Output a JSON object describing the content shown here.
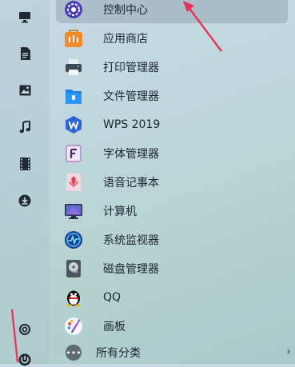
{
  "sidebar": {
    "icons": [
      "computer-icon",
      "document-icon",
      "picture-icon",
      "music-icon",
      "video-icon",
      "download-icon",
      "settings-icon",
      "power-icon"
    ]
  },
  "apps": [
    {
      "label": "控制中心",
      "icon": "control-center-icon",
      "active": true
    },
    {
      "label": "应用商店",
      "icon": "app-store-icon",
      "active": false
    },
    {
      "label": "打印管理器",
      "icon": "printer-icon",
      "active": false
    },
    {
      "label": "文件管理器",
      "icon": "file-manager-icon",
      "active": false
    },
    {
      "label": "WPS 2019",
      "icon": "wps-icon",
      "active": false
    },
    {
      "label": "字体管理器",
      "icon": "font-manager-icon",
      "active": false
    },
    {
      "label": "语音记事本",
      "icon": "voice-notepad-icon",
      "active": false
    },
    {
      "label": "计算机",
      "icon": "computer-app-icon",
      "active": false
    },
    {
      "label": "系统监视器",
      "icon": "system-monitor-icon",
      "active": false
    },
    {
      "label": "磁盘管理器",
      "icon": "disk-manager-icon",
      "active": false
    },
    {
      "label": "QQ",
      "icon": "qq-icon",
      "active": false
    },
    {
      "label": "画板",
      "icon": "drawing-board-icon",
      "active": false
    }
  ],
  "footer": {
    "all_categories_label": "所有分类",
    "more_glyph": "•••",
    "chevron_glyph": "›"
  },
  "colors": {
    "annotation_arrow": "#e8325a",
    "active_row": "#7b8c9b"
  }
}
